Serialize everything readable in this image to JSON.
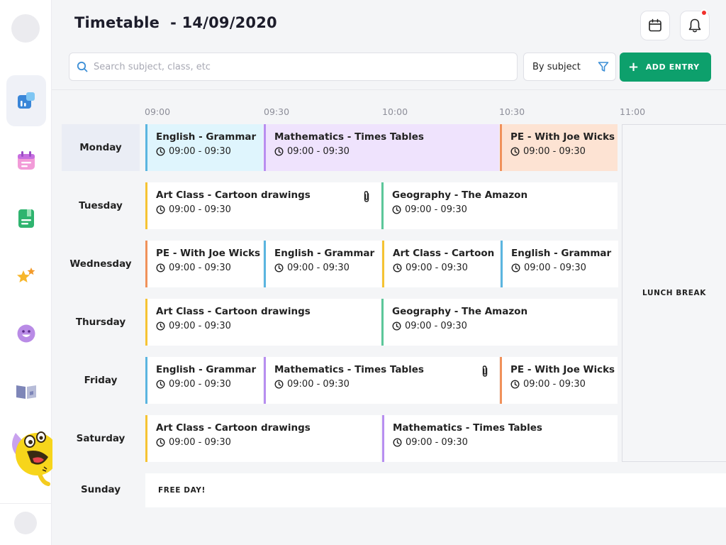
{
  "header": {
    "title": "Timetable  - 14/09/2020",
    "calendar_icon": "calendar-icon",
    "bell_icon": "bell-icon"
  },
  "search": {
    "placeholder": "Search subject, class, etc",
    "value": ""
  },
  "filter": {
    "label": "By subject",
    "icon": "filter-icon"
  },
  "add_button": {
    "label": "ADD ENTRY",
    "icon": "plus-icon"
  },
  "sidebar": {
    "items": [
      {
        "name": "dashboard",
        "icon": "dashboard-icon",
        "active": true
      },
      {
        "name": "planner",
        "icon": "planner-icon",
        "active": false
      },
      {
        "name": "book",
        "icon": "book-icon",
        "active": false
      },
      {
        "name": "rewards",
        "icon": "stars-icon",
        "active": false
      },
      {
        "name": "emotions",
        "icon": "smiley-icon",
        "active": false
      },
      {
        "name": "library",
        "icon": "open-book-icon",
        "active": false
      }
    ]
  },
  "times": [
    "09:00",
    "09:30",
    "10:00",
    "10:30",
    "11:00"
  ],
  "days": [
    {
      "label": "Monday",
      "entries": [
        {
          "title": "English - Grammar",
          "time": "09:00 - 09:30"
        },
        {
          "title": "Mathematics - Times Tables",
          "time": "09:00 - 09:30"
        },
        {
          "title": "PE - With Joe Wicks",
          "time": "09:00 - 09:30"
        }
      ]
    },
    {
      "label": "Tuesday",
      "entries": [
        {
          "title": "Art Class - Cartoon drawings",
          "time": "09:00 - 09:30"
        },
        {
          "title": "Geography - The Amazon",
          "time": "09:00 - 09:30"
        }
      ]
    },
    {
      "label": "Wednesday",
      "entries": [
        {
          "title": "PE - With Joe Wicks",
          "time": "09:00 - 09:30"
        },
        {
          "title": "English - Grammar",
          "time": "09:00 - 09:30"
        },
        {
          "title": "Art Class - Cartoon",
          "time": "09:00 - 09:30"
        },
        {
          "title": "English - Grammar",
          "time": "09:00 - 09:30"
        }
      ]
    },
    {
      "label": "Thursday",
      "entries": [
        {
          "title": "Art Class - Cartoon drawings",
          "time": "09:00 - 09:30"
        },
        {
          "title": "Geography - The Amazon",
          "time": "09:00 - 09:30"
        }
      ]
    },
    {
      "label": "Friday",
      "entries": [
        {
          "title": "English - Grammar",
          "time": "09:00 - 09:30"
        },
        {
          "title": "Mathematics - Times Tables",
          "time": "09:00 - 09:30"
        },
        {
          "title": "PE - With Joe Wicks",
          "time": "09:00 - 09:30"
        }
      ]
    },
    {
      "label": "Saturday",
      "entries": [
        {
          "title": "Art Class - Cartoon drawings",
          "time": "09:00 - 09:30"
        },
        {
          "title": "Mathematics - Times Tables",
          "time": "09:00 - 09:30"
        }
      ]
    },
    {
      "label": "Sunday",
      "note": "FREE DAY!"
    }
  ],
  "lunch_label": "LUNCH BREAK",
  "colors": {
    "english": "#5bb5e0",
    "english_bg": "#dff5fd",
    "maths": "#b78ef0",
    "maths_bg": "#efe3fd",
    "pe": "#f0915a",
    "pe_bg": "#fde3d3",
    "art": "#f5c333",
    "geography": "#5cc79a",
    "accent_green": "#0da06c",
    "notification": "#f1312c"
  }
}
